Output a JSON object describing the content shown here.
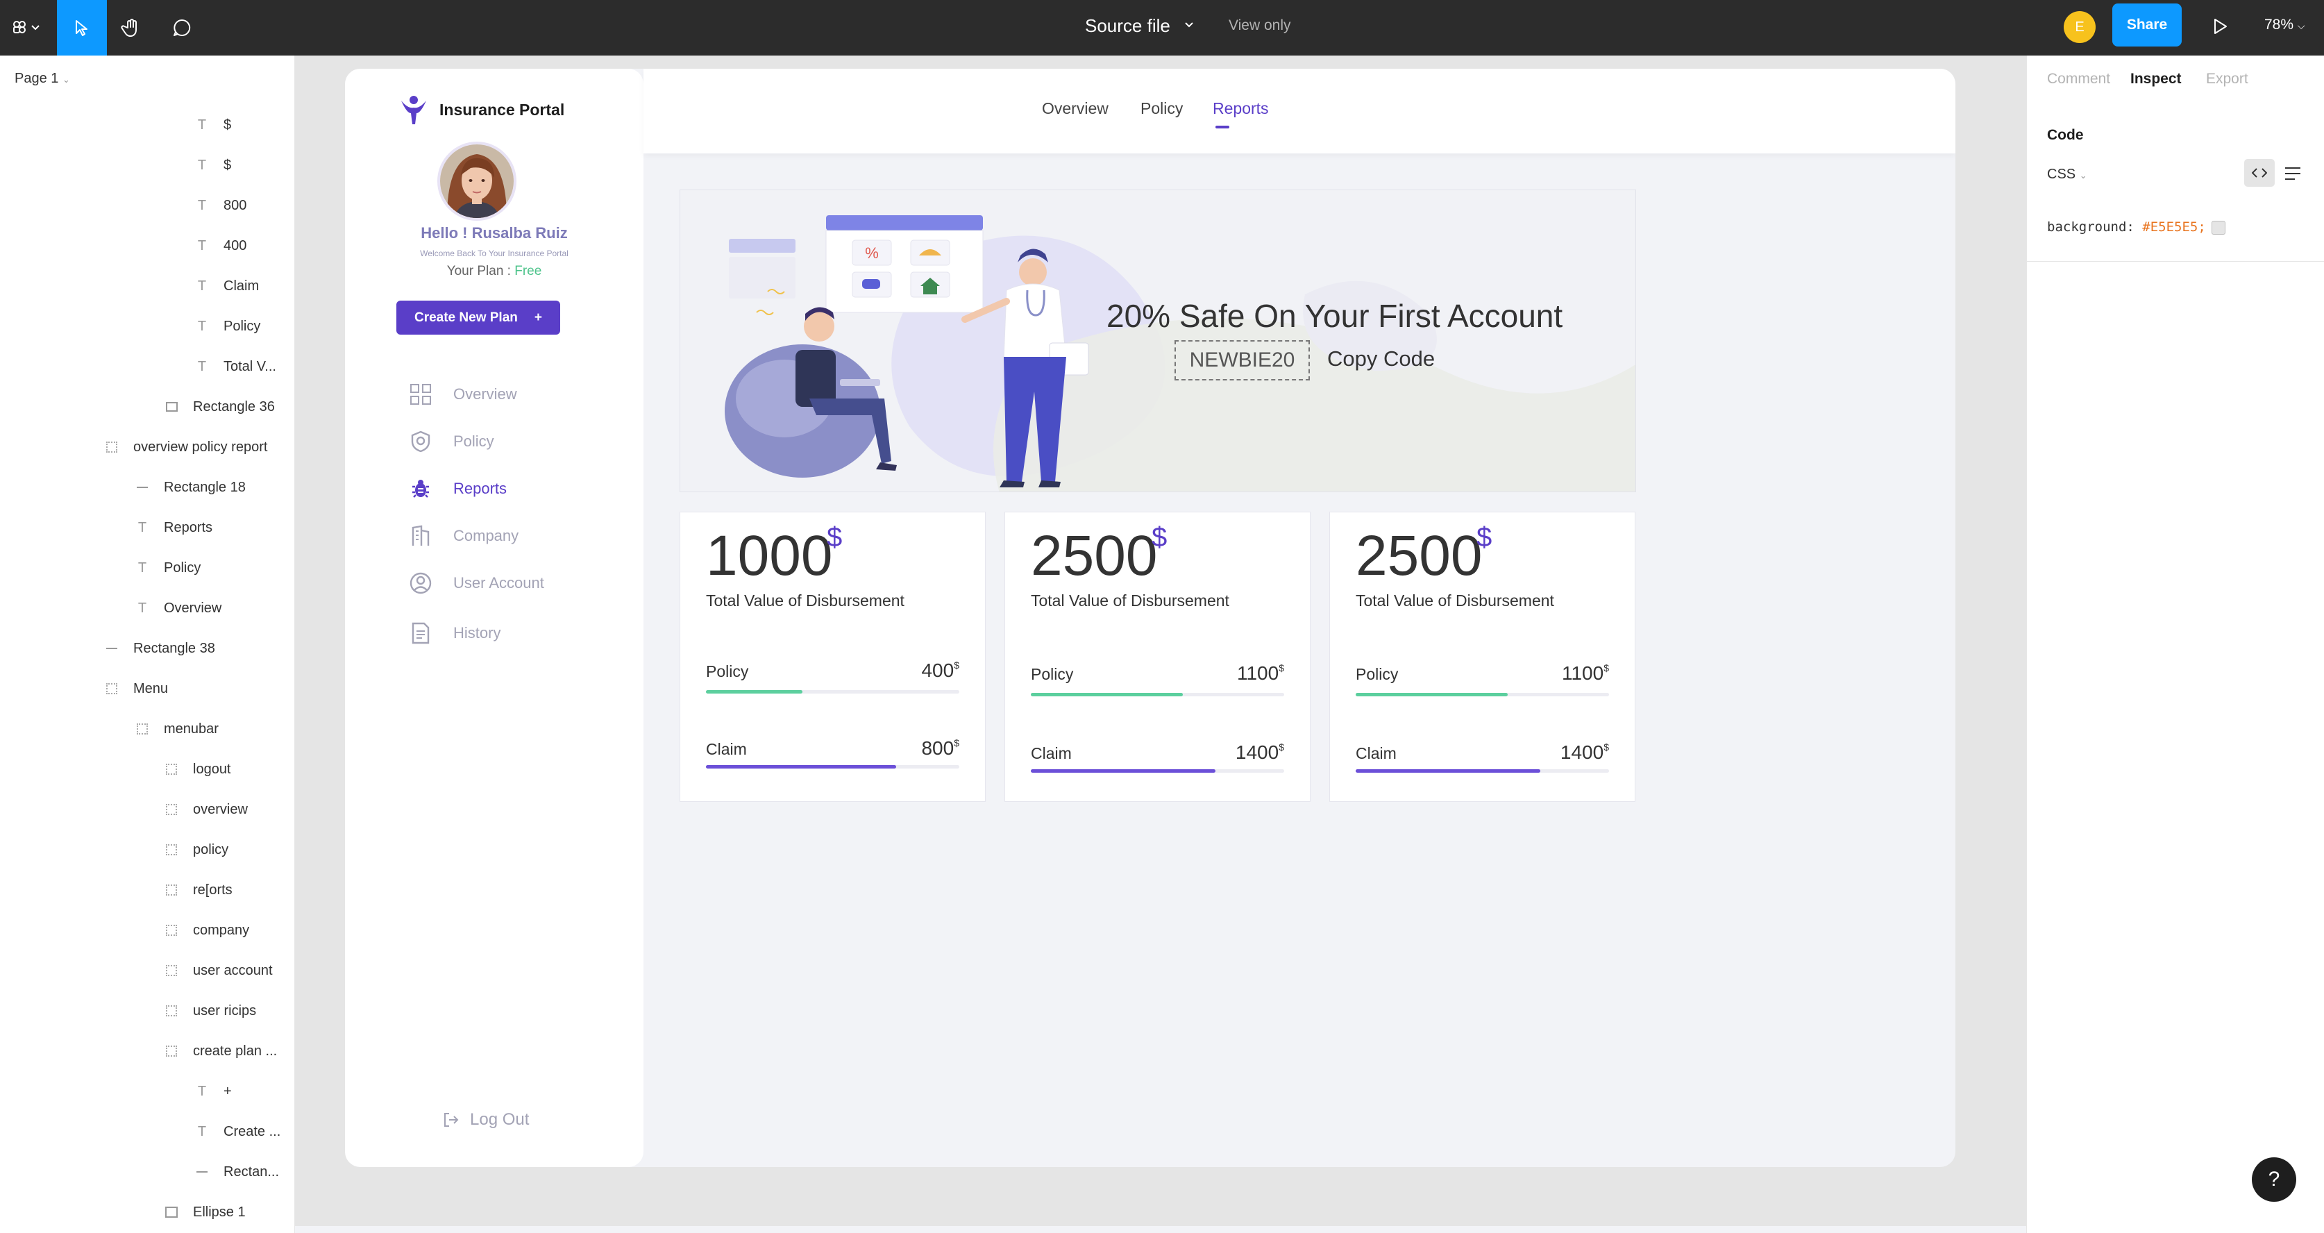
{
  "toolbar": {
    "document_title": "Source file",
    "view_mode": "View only",
    "user_initial": "E",
    "share_label": "Share",
    "zoom": "78%"
  },
  "layers_panel": {
    "page_name": "Page 1",
    "items": [
      {
        "label": "$",
        "kind": "text"
      },
      {
        "label": "$",
        "kind": "text"
      },
      {
        "label": "800",
        "kind": "text"
      },
      {
        "label": "400",
        "kind": "text"
      },
      {
        "label": "Claim",
        "kind": "text"
      },
      {
        "label": "Policy",
        "kind": "text"
      },
      {
        "label": "Total V...",
        "kind": "text"
      },
      {
        "label": "Rectangle 36",
        "kind": "rect"
      },
      {
        "label": "overview policy report",
        "kind": "frame"
      },
      {
        "label": "Rectangle 18",
        "kind": "line"
      },
      {
        "label": "Reports",
        "kind": "text"
      },
      {
        "label": "Policy",
        "kind": "text"
      },
      {
        "label": "Overview",
        "kind": "text"
      },
      {
        "label": "Rectangle 38",
        "kind": "line"
      },
      {
        "label": "Menu",
        "kind": "frame"
      },
      {
        "label": "menubar",
        "kind": "frame"
      },
      {
        "label": "logout",
        "kind": "frame"
      },
      {
        "label": "overview",
        "kind": "frame"
      },
      {
        "label": "policy",
        "kind": "frame"
      },
      {
        "label": "re[orts",
        "kind": "frame"
      },
      {
        "label": "company",
        "kind": "frame"
      },
      {
        "label": "user account",
        "kind": "frame"
      },
      {
        "label": "user ricips",
        "kind": "frame"
      },
      {
        "label": "create plan ...",
        "kind": "frame"
      },
      {
        "label": "+",
        "kind": "text"
      },
      {
        "label": "Create ...",
        "kind": "text"
      },
      {
        "label": "Rectan...",
        "kind": "line"
      },
      {
        "label": "Ellipse 1",
        "kind": "image"
      }
    ]
  },
  "inspect_panel": {
    "tabs": [
      "Comment",
      "Inspect",
      "Export"
    ],
    "active_tab": "Inspect",
    "section_title": "Code",
    "language": "CSS",
    "css_property": "background:",
    "css_value": "#E5E5E5;",
    "help_label": "?"
  },
  "app": {
    "brand": "Insurance Portal",
    "greeting": "Hello ! Rusalba Ruiz",
    "welcome": "Welcome Back To Your Insurance Portal",
    "plan_label": "Your Plan :",
    "plan_value": "Free",
    "create_button": "Create New Plan",
    "create_button_icon": "+",
    "nav": [
      {
        "label": "Overview",
        "icon": "grid-icon",
        "active": false
      },
      {
        "label": "Policy",
        "icon": "shield-icon",
        "active": false
      },
      {
        "label": "Reports",
        "icon": "bug-icon",
        "active": true
      },
      {
        "label": "Company",
        "icon": "building-icon",
        "active": false
      },
      {
        "label": "User Account",
        "icon": "user-circle-icon",
        "active": false
      },
      {
        "label": "History",
        "icon": "document-icon",
        "active": false
      }
    ],
    "logout": "Log Out",
    "top_tabs": [
      "Overview",
      "Policy",
      "Reports"
    ],
    "active_top_tab": "Reports",
    "banner": {
      "headline": "20% Safe On Your First Account",
      "promo_code": "NEWBIE20",
      "copy_label": "Copy Code"
    },
    "cards": [
      {
        "total": "1000",
        "currency": "$",
        "label": "Total Value of Disbursement",
        "policy_label": "Policy",
        "policy_value": "400",
        "policy_progress": 0.38,
        "claim_label": "Claim",
        "claim_value": "800",
        "claim_progress": 0.75
      },
      {
        "total": "2500",
        "currency": "$",
        "label": "Total Value of Disbursement",
        "policy_label": "Policy",
        "policy_value": "1100",
        "policy_progress": 0.6,
        "claim_label": "Claim",
        "claim_value": "1400",
        "claim_progress": 0.73
      },
      {
        "total": "2500",
        "currency": "$",
        "label": "Total Value of Disbursement",
        "policy_label": "Policy",
        "policy_value": "1100",
        "policy_progress": 0.6,
        "claim_label": "Claim",
        "claim_value": "1400",
        "claim_progress": 0.73
      }
    ]
  },
  "colors": {
    "accent": "#5A3EC8",
    "policy_bar": "#5CCF9E",
    "claim_bar": "#6B4FD8",
    "figma_blue": "#0D99FF"
  }
}
